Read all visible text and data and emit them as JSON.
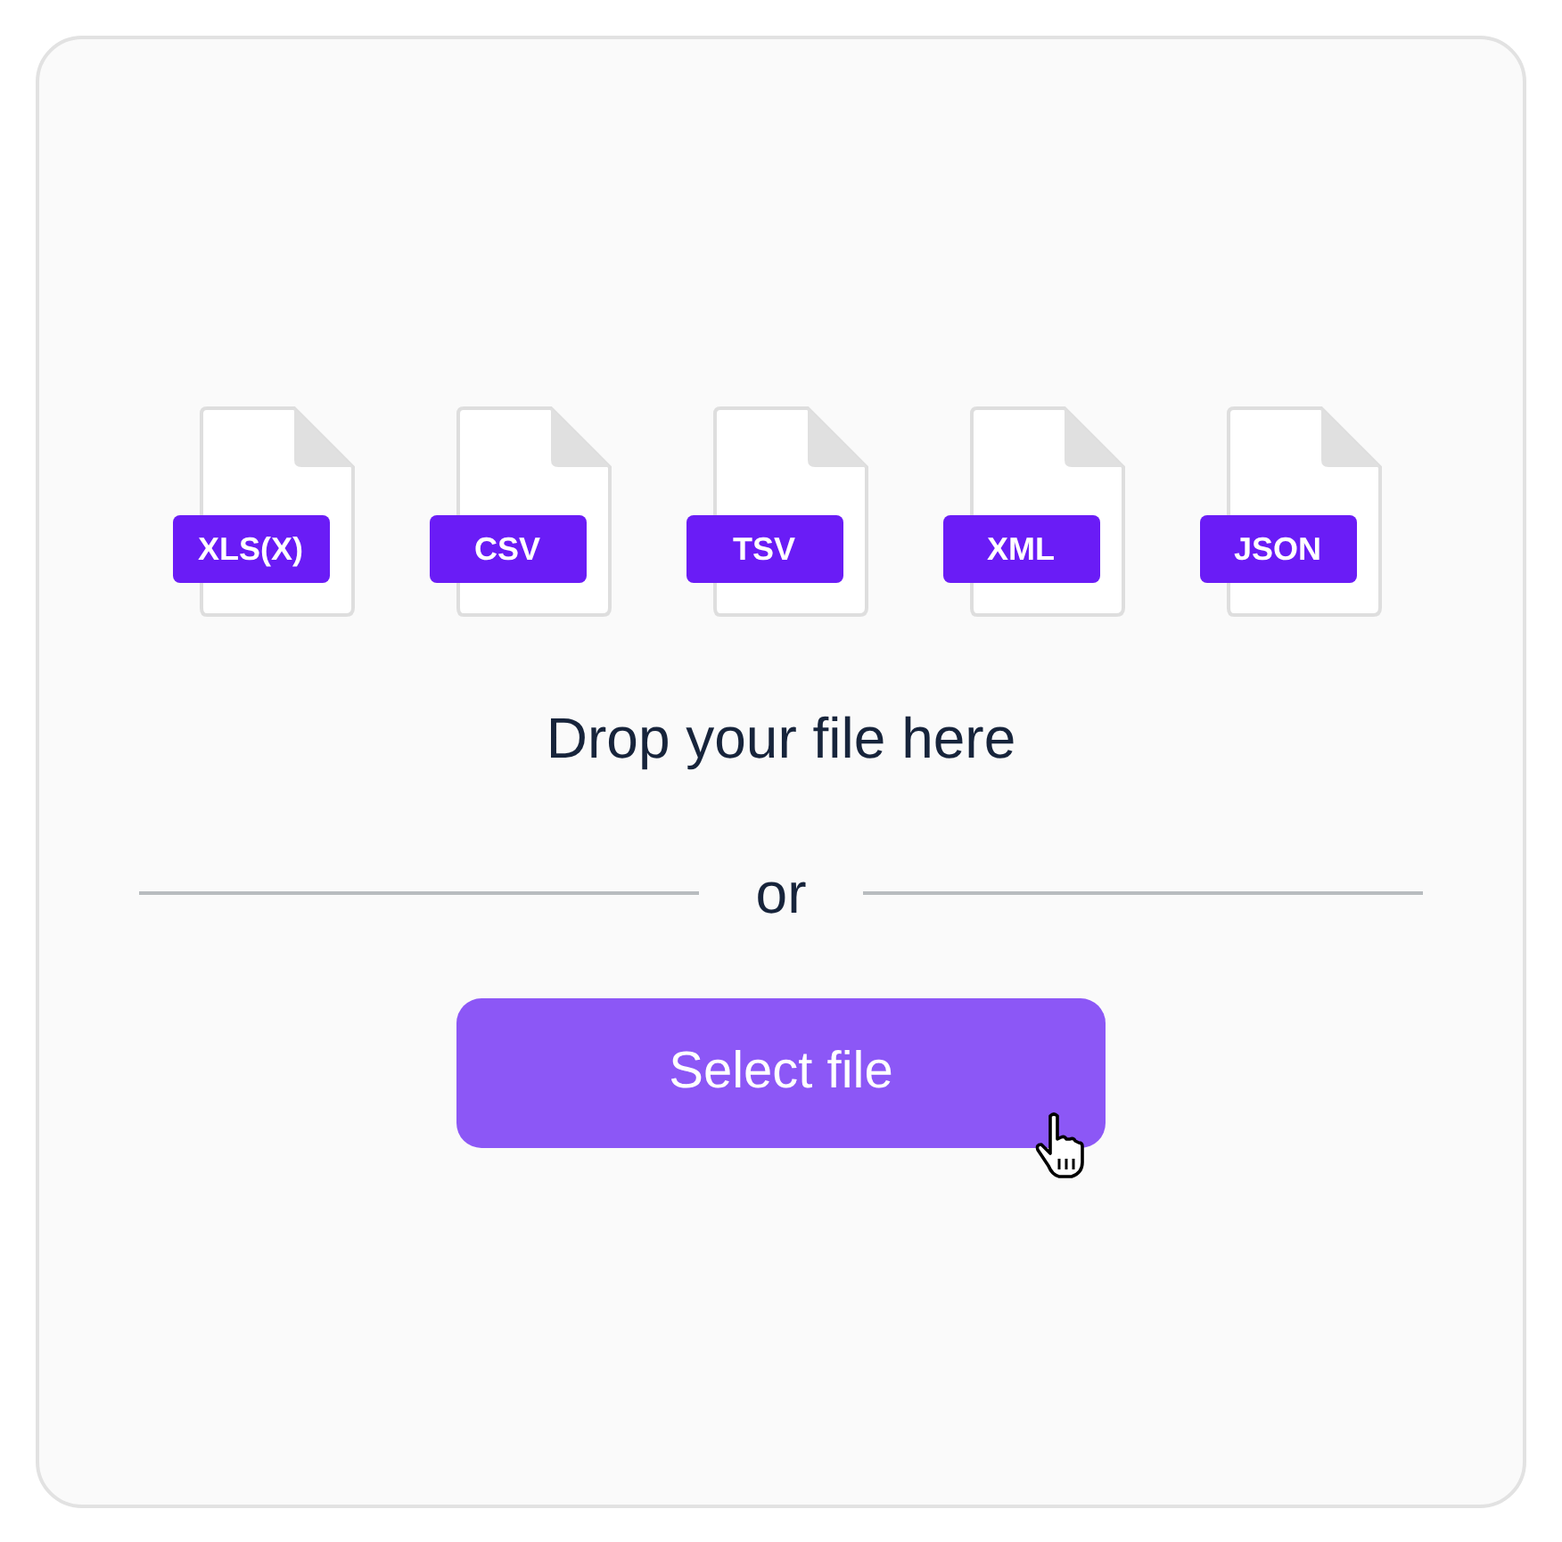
{
  "file_types": [
    {
      "label": "XLS(X)"
    },
    {
      "label": "CSV"
    },
    {
      "label": "TSV"
    },
    {
      "label": "XML"
    },
    {
      "label": "JSON"
    }
  ],
  "prompt": "Drop your file here",
  "separator": "or",
  "button": {
    "label": "Select file"
  }
}
